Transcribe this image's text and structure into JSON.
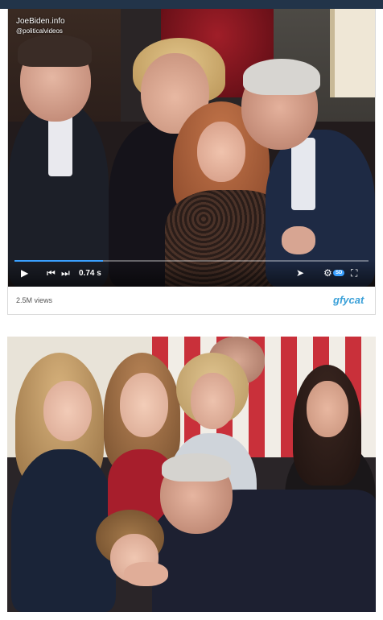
{
  "video": {
    "watermark_site": "JoeBiden.info",
    "watermark_handle": "@politicalvideos",
    "speed_label": "0.74 s",
    "quality_badge": "SD",
    "progress": 0.25
  },
  "meta": {
    "views": "2.5M views",
    "brand": "gfycat"
  },
  "icons": {
    "play": "▶",
    "prev": "⏮",
    "next": "⏭",
    "share": "➤",
    "settings": "⚙",
    "fullscreen": "⛶"
  },
  "colors": {
    "accent": "#3aa0ff",
    "brand": "#3aa0d8",
    "topbar": "#223449"
  }
}
